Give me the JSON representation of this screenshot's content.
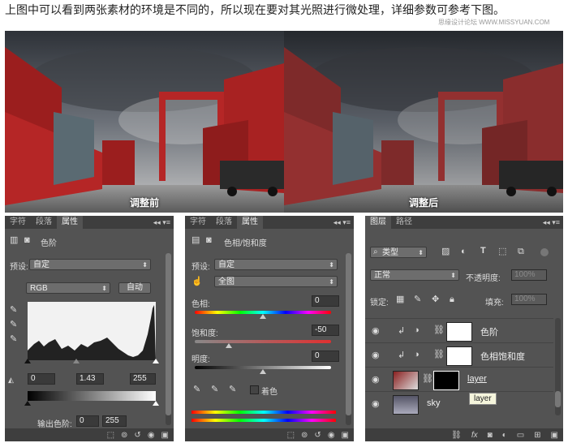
{
  "caption": "上图中可以看到两张素材的环境是不同的，所以现在要对其光照进行微处理，详细参数可参考下图。",
  "watermark": "思缘设计论坛 WWW.MISSYUAN.COM",
  "photos": {
    "before_label": "调整前",
    "after_label": "调整后"
  },
  "levels_panel": {
    "tabs": [
      "字符",
      "段落",
      "属性"
    ],
    "menu": "◂◂ ▾≡",
    "title": "色阶",
    "preset_label": "预设:",
    "preset_value": "自定",
    "channel_value": "RGB",
    "auto_button": "自动",
    "input_black": "0",
    "input_gamma": "1.43",
    "input_white": "255",
    "output_label": "输出色阶:",
    "output_black": "0",
    "output_white": "255"
  },
  "hue_panel": {
    "tabs": [
      "字符",
      "段落",
      "属性"
    ],
    "menu": "◂◂ ▾≡",
    "title": "色相/饱和度",
    "preset_label": "预设:",
    "preset_value": "自定",
    "range_value": "全图",
    "hue_label": "色相:",
    "hue_value": "0",
    "saturation_label": "饱和度:",
    "saturation_value": "-50",
    "lightness_label": "明度:",
    "lightness_value": "0",
    "colorize_label": "着色"
  },
  "layers_panel": {
    "tabs": [
      "图层",
      "路径"
    ],
    "menu": "◂◂ ▾≡",
    "filter_type": "类型",
    "blend_mode": "正常",
    "opacity_label": "不透明度:",
    "opacity_value": "100%",
    "lock_label": "锁定:",
    "fill_label": "填充:",
    "fill_value": "100%",
    "layers": [
      {
        "name": "色阶"
      },
      {
        "name": "色相饱和度"
      },
      {
        "name": "layer"
      },
      {
        "name": "sky"
      }
    ],
    "tooltip": "layer"
  }
}
